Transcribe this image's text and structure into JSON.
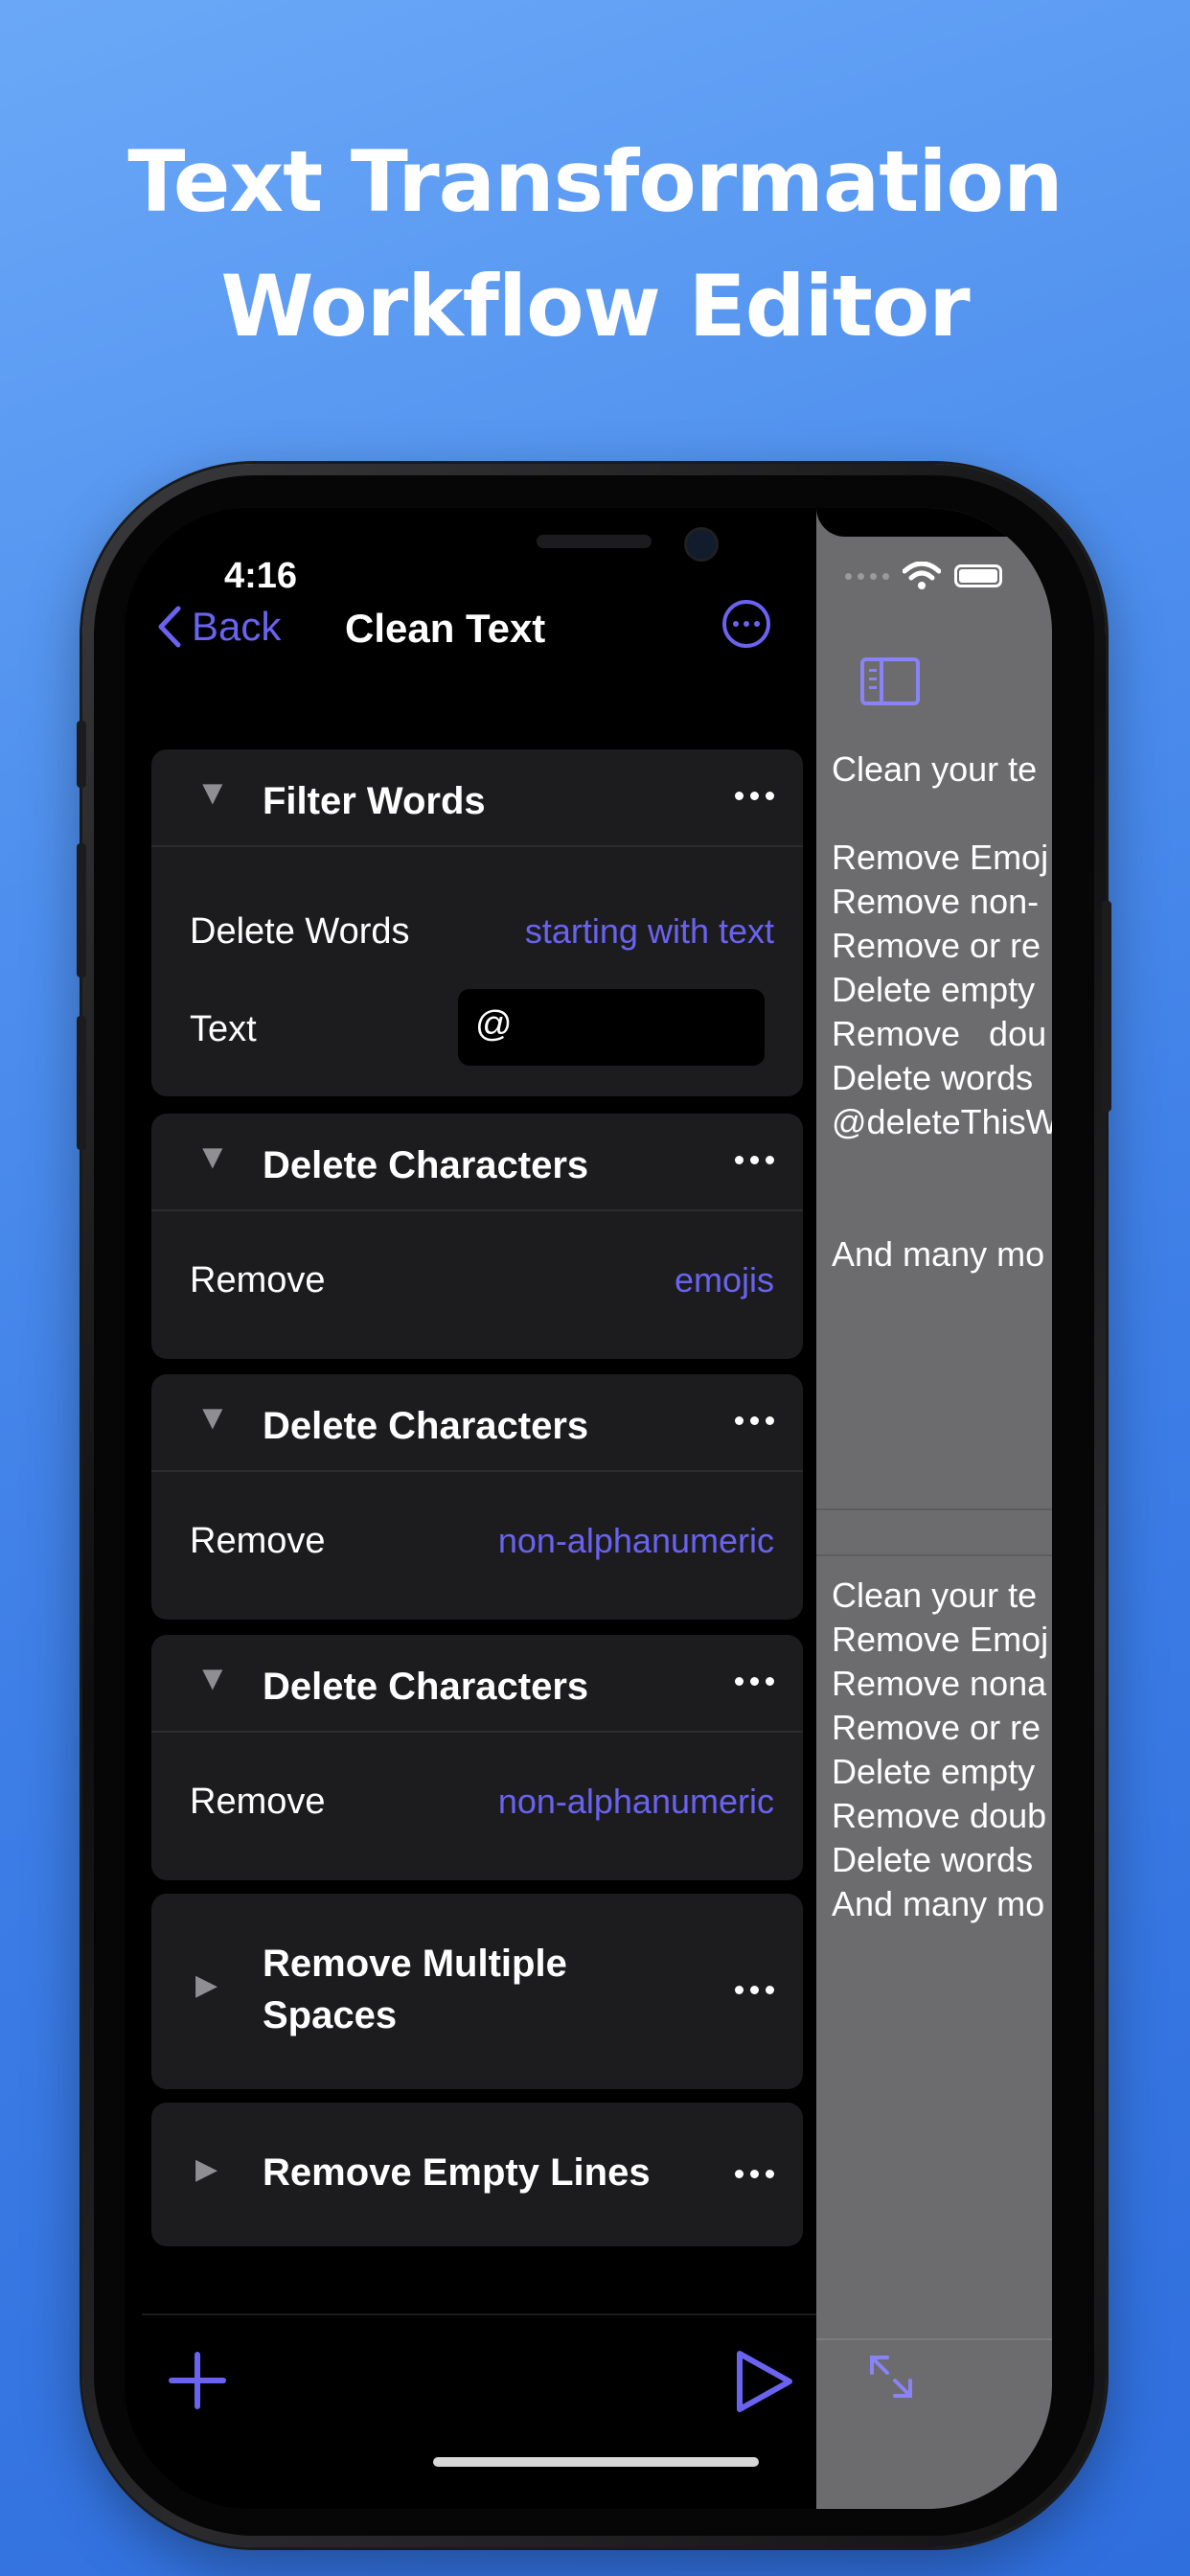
{
  "headline": {
    "line1": "Text Transformation",
    "line2": "Workflow Editor"
  },
  "status": {
    "time": "4:16"
  },
  "nav": {
    "back_label": "Back",
    "title": "Clean Text"
  },
  "cards": [
    {
      "title": "Filter Words",
      "expanded": true,
      "rows": [
        {
          "label": "Delete Words",
          "value": "starting with text"
        },
        {
          "label": "Text",
          "field_value": "@"
        }
      ]
    },
    {
      "title": "Delete Characters",
      "expanded": true,
      "rows": [
        {
          "label": "Remove",
          "value": "emojis"
        }
      ]
    },
    {
      "title": "Delete Characters",
      "expanded": true,
      "rows": [
        {
          "label": "Remove",
          "value": "non-alphanumeric"
        }
      ]
    },
    {
      "title": "Delete Characters",
      "expanded": true,
      "rows": [
        {
          "label": "Remove",
          "value": "non-alphanumeric"
        }
      ]
    },
    {
      "title_line1": "Remove Multiple",
      "title_line2": "Spaces",
      "expanded": false
    },
    {
      "title": "Remove Empty Lines",
      "expanded": false
    }
  ],
  "preview": {
    "input_text": "Clean your te\n\nRemove Emoj\nRemove non-\nRemove or re\nDelete empty\nRemove   dou\nDelete words\n@deleteThisW\n\n\nAnd many mo",
    "output_text": "Clean your te\nRemove Emoj\nRemove nona\nRemove or re\nDelete empty\nRemove doub\nDelete words\nAnd many mo"
  },
  "colors": {
    "accent": "#6a63f0",
    "card_bg": "#1c1c1e",
    "preview_bg": "#6c6c6e"
  },
  "icons": [
    "chevron-left-icon",
    "more-circle-icon",
    "sidebar-icon",
    "ellipsis-icon",
    "disclosure-down-icon",
    "disclosure-right-icon",
    "plus-icon",
    "play-icon",
    "expand-icon",
    "wifi-icon",
    "battery-icon"
  ]
}
